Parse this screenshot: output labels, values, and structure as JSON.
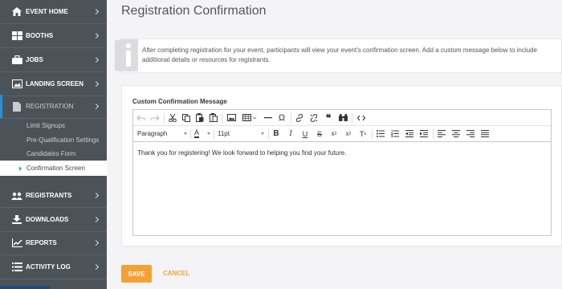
{
  "sidebar": {
    "items": [
      {
        "label": "EVENT HOME",
        "icon": "home-icon"
      },
      {
        "label": "BOOTHS",
        "icon": "booths-icon"
      },
      {
        "label": "JOBS",
        "icon": "briefcase-icon"
      },
      {
        "label": "LANDING SCREEN",
        "icon": "image-icon"
      },
      {
        "label": "REGISTRATION",
        "icon": "document-icon"
      },
      {
        "label": "REGISTRANTS",
        "icon": "users-icon"
      },
      {
        "label": "DOWNLOADS",
        "icon": "download-icon"
      },
      {
        "label": "REPORTS",
        "icon": "chart-icon"
      },
      {
        "label": "ACTIVITY LOG",
        "icon": "list-icon"
      }
    ],
    "sub_items": [
      "Limit Signups",
      "Pre-Qualification Settings",
      "Candidates Form",
      "Confirmation Screen"
    ]
  },
  "main": {
    "title": "Registration Confirmation",
    "info_text": "After completing registration for your event, participants will view your event's confirmation screen. Add a custom message below to include additional details or resources for registrants.",
    "field_label": "Custom Confirmation Message",
    "editor": {
      "block_format": "Paragraph",
      "font_color_label": "A",
      "font_size": "11pt",
      "content": "Thank you for registering! We look forward to helping you find your future."
    },
    "save_label": "SAVE",
    "cancel_label": "CANCEL"
  },
  "colors": {
    "sidebar_bg": "#4c5358",
    "accent_orange": "#f5a033",
    "active_blue": "#2a8fd6"
  }
}
